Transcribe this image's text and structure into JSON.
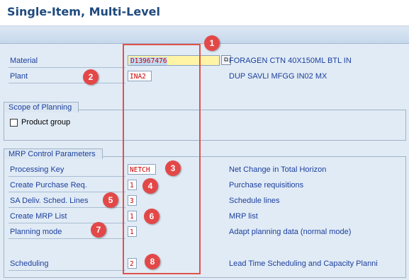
{
  "page_title": "Single-Item, Multi-Level",
  "header_fields": {
    "material_label": "Material",
    "material_value": "D13967476",
    "material_desc": "FORAGEN CTN 40X150ML BTL IN",
    "plant_label": "Plant",
    "plant_value": "INA2",
    "plant_desc": "DUP SAVLI MFGG IN02 MX"
  },
  "scope": {
    "title": "Scope of Planning",
    "product_group_label": "Product group",
    "product_group_checked": false
  },
  "mrp": {
    "title": "MRP Control Parameters",
    "processing_key_label": "Processing Key",
    "processing_key_value": "NETCH",
    "processing_key_desc": "Net Change in Total Horizon",
    "create_pr_label": "Create Purchase Req.",
    "create_pr_value": "1",
    "create_pr_desc": "Purchase requisitions",
    "sa_deliv_label": "SA Deliv. Sched. Lines",
    "sa_deliv_value": "3",
    "sa_deliv_desc": "Schedule lines",
    "create_mrp_label": "Create MRP List",
    "create_mrp_value": "1",
    "create_mrp_desc": "MRP list",
    "planning_mode_label": "Planning mode",
    "planning_mode_value": "1",
    "planning_mode_desc": "Adapt planning data (normal mode)",
    "scheduling_label": "Scheduling",
    "scheduling_value": "2",
    "scheduling_desc": "Lead Time Scheduling and Capacity Planni"
  },
  "annotations": {
    "badge_1": "1",
    "badge_2": "2",
    "badge_3": "3",
    "badge_4": "4",
    "badge_5": "5",
    "badge_6": "6",
    "badge_7": "7",
    "badge_8": "8",
    "color": "#e34848"
  },
  "icons": {
    "material_search": "search-help-icon"
  }
}
